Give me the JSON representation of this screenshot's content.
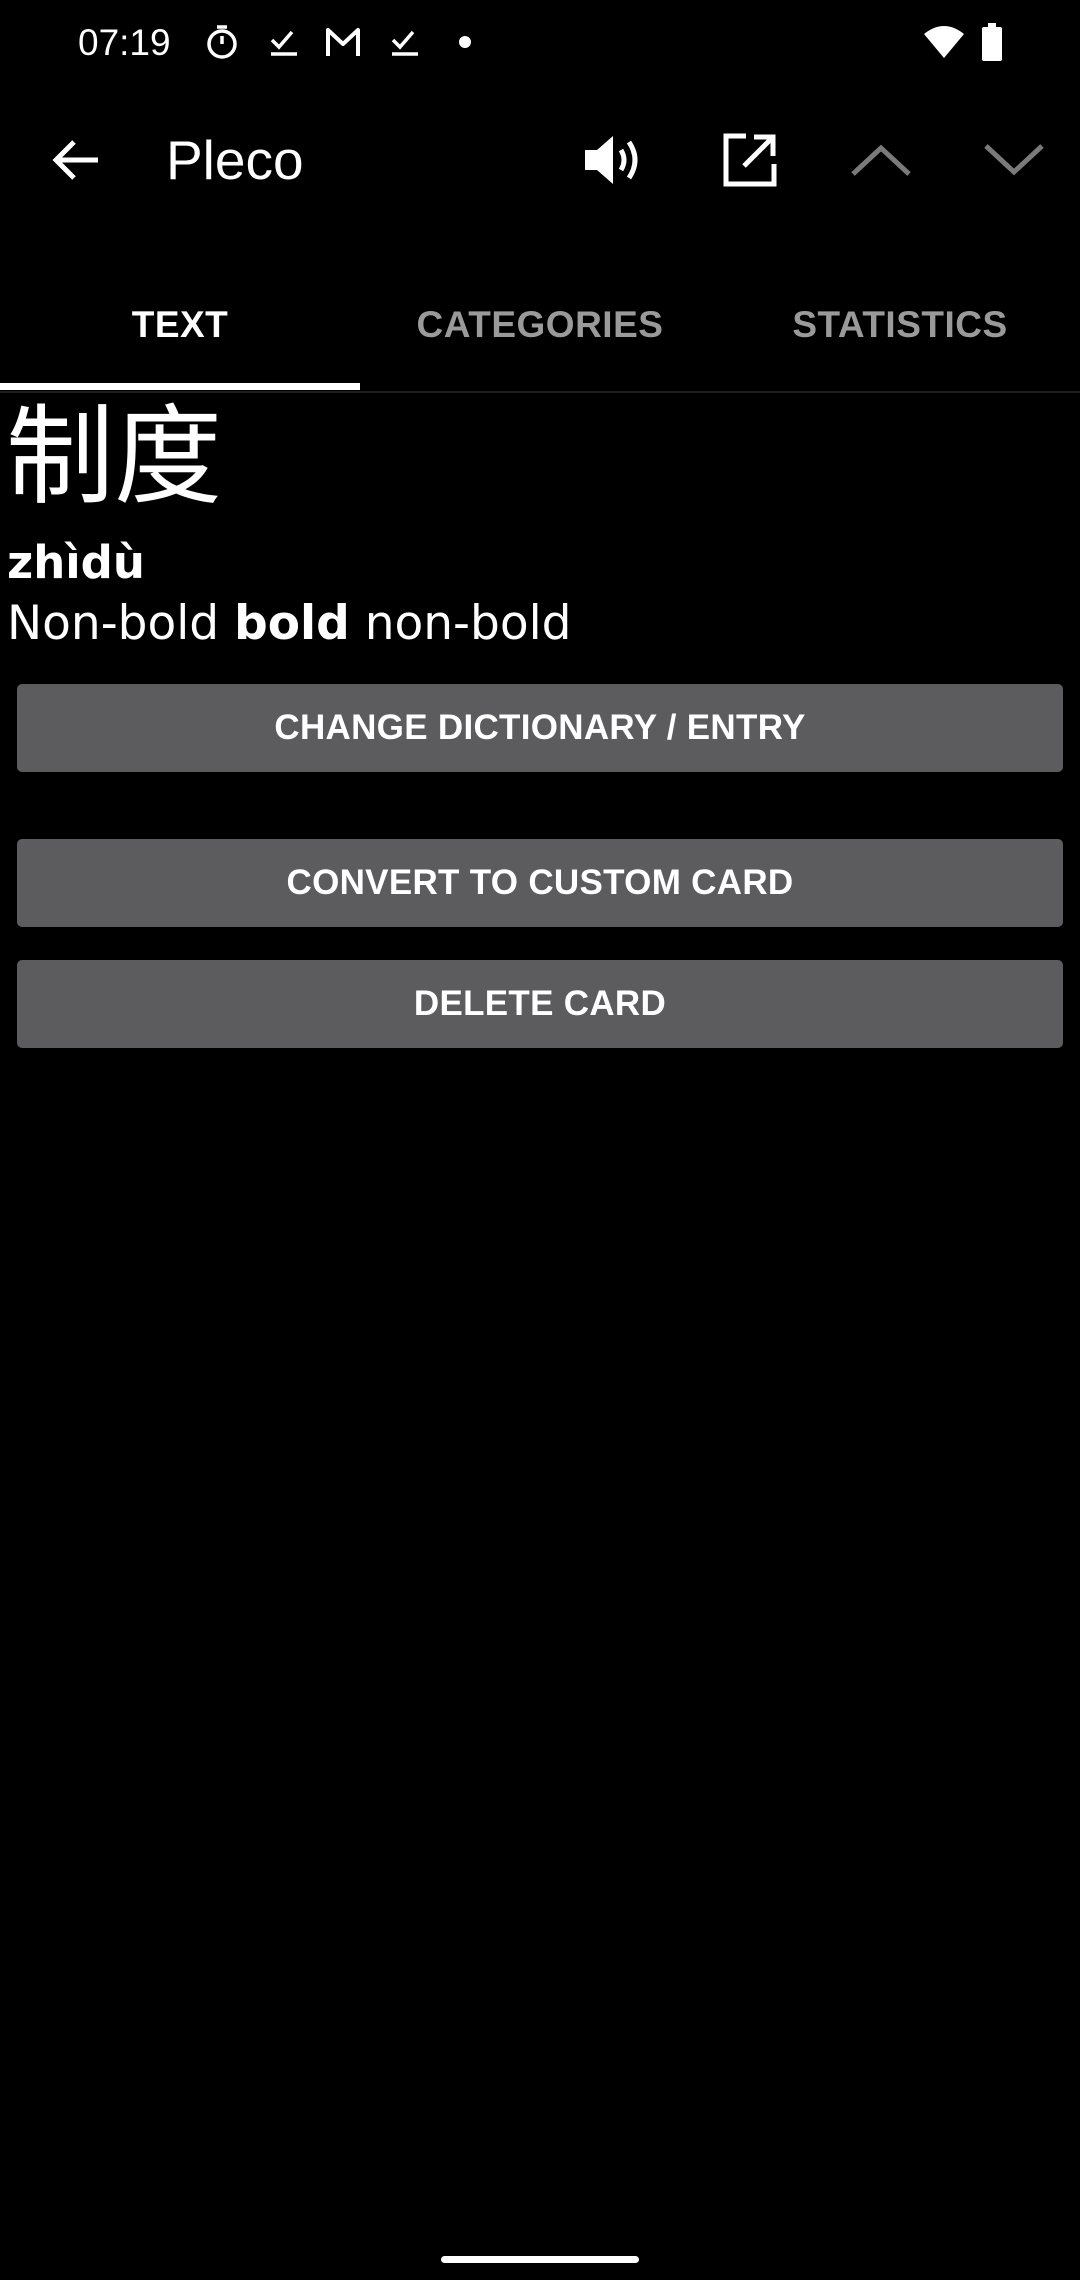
{
  "status_bar": {
    "time": "07:19",
    "icons": [
      "timer-icon",
      "task-check-icon",
      "gmail-icon",
      "task-check-icon",
      "notification-dot-icon",
      "wifi-icon",
      "battery-icon"
    ]
  },
  "app_bar": {
    "title": "Pleco",
    "icons": [
      "back-arrow-icon",
      "speaker-icon",
      "open-external-icon",
      "chevron-up-icon",
      "chevron-down-icon"
    ]
  },
  "tabs": [
    {
      "label": "TEXT",
      "active": true
    },
    {
      "label": "CATEGORIES",
      "active": false
    },
    {
      "label": "STATISTICS",
      "active": false
    }
  ],
  "card": {
    "headword": "制度",
    "pinyin": "zhìdù",
    "definition": {
      "part1": "Non-bold ",
      "bold": "bold",
      "part2": " non-bold"
    }
  },
  "buttons": {
    "change_dictionary": "CHANGE DICTIONARY / ENTRY",
    "convert_custom": "CONVERT TO CUSTOM CARD",
    "delete_card": "DELETE CARD"
  },
  "colors": {
    "background": "#000000",
    "button_bg": "#5c5c5e",
    "tab_inactive": "#9a9a9a",
    "text": "#ffffff"
  }
}
